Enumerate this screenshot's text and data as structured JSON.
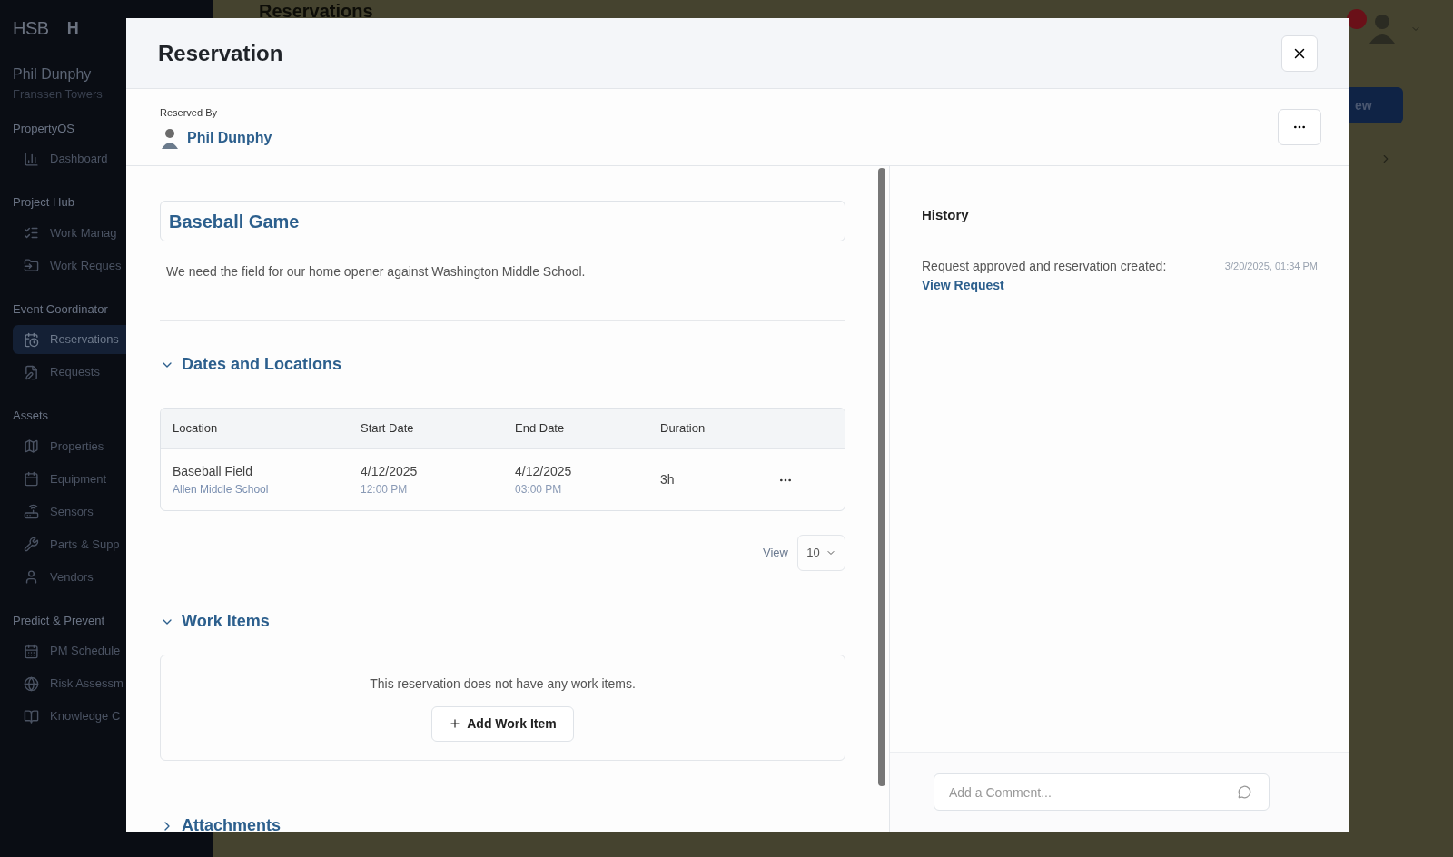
{
  "sidebar": {
    "logo": "HSB",
    "app_initial": "H",
    "user": {
      "name": "Phil Dunphy",
      "property": "Franssen Towers"
    },
    "sections": [
      {
        "title": "PropertyOS",
        "items": [
          {
            "label": "Dashboard",
            "kind": "chart",
            "selected": false
          }
        ]
      },
      {
        "title": "Project Hub",
        "items": [
          {
            "label": "Work Manag",
            "kind": "list",
            "selected": false
          },
          {
            "label": "Work Reques",
            "kind": "inbox",
            "selected": false
          }
        ]
      },
      {
        "title": "Event Coordinator",
        "items": [
          {
            "label": "Reservations",
            "kind": "calendar-clock",
            "selected": true
          },
          {
            "label": "Requests",
            "kind": "edit",
            "selected": false
          }
        ]
      },
      {
        "title": "Assets",
        "items": [
          {
            "label": "Properties",
            "kind": "map",
            "selected": false
          },
          {
            "label": "Equipment",
            "kind": "calendar",
            "selected": false
          },
          {
            "label": "Sensors",
            "kind": "router",
            "selected": false
          },
          {
            "label": "Parts & Supp",
            "kind": "tools",
            "selected": false
          },
          {
            "label": "Vendors",
            "kind": "user",
            "selected": false
          }
        ]
      },
      {
        "title": "Predict & Prevent",
        "items": [
          {
            "label": "PM Schedule",
            "kind": "calendar-days",
            "selected": false
          },
          {
            "label": "Risk Assessm",
            "kind": "globe",
            "selected": false
          },
          {
            "label": "Knowledge C",
            "kind": "book",
            "selected": false
          }
        ]
      }
    ]
  },
  "background": {
    "page_title": "Reservations",
    "header_button": "ew"
  },
  "modal": {
    "title": "Reservation",
    "reserved_by_label": "Reserved By",
    "reserved_by": "Phil Dunphy",
    "name": "Baseball Game",
    "description": "We need the field for our home opener against Washington Middle School.",
    "dates_section": {
      "title": "Dates and Locations",
      "expanded": true,
      "columns": [
        "Location",
        "Start Date",
        "End Date",
        "Duration"
      ],
      "rows": [
        {
          "location": "Baseball Field",
          "sublocation": "Allen Middle School",
          "start_date": "4/12/2025",
          "start_time": "12:00 PM",
          "end_date": "4/12/2025",
          "end_time": "03:00 PM",
          "duration": "3h"
        }
      ],
      "view_label": "View",
      "page_size": "10"
    },
    "work_items": {
      "title": "Work Items",
      "expanded": true,
      "empty_message": "This reservation does not have any work items.",
      "add_button": "Add Work Item"
    },
    "attachments": {
      "title": "Attachments",
      "expanded": false
    },
    "history": {
      "title": "History",
      "entries": [
        {
          "text": "Request approved and reservation created:",
          "link": "View Request",
          "time": "3/20/2025, 01:34 PM"
        }
      ]
    },
    "comment": {
      "placeholder": "Add a Comment..."
    }
  }
}
